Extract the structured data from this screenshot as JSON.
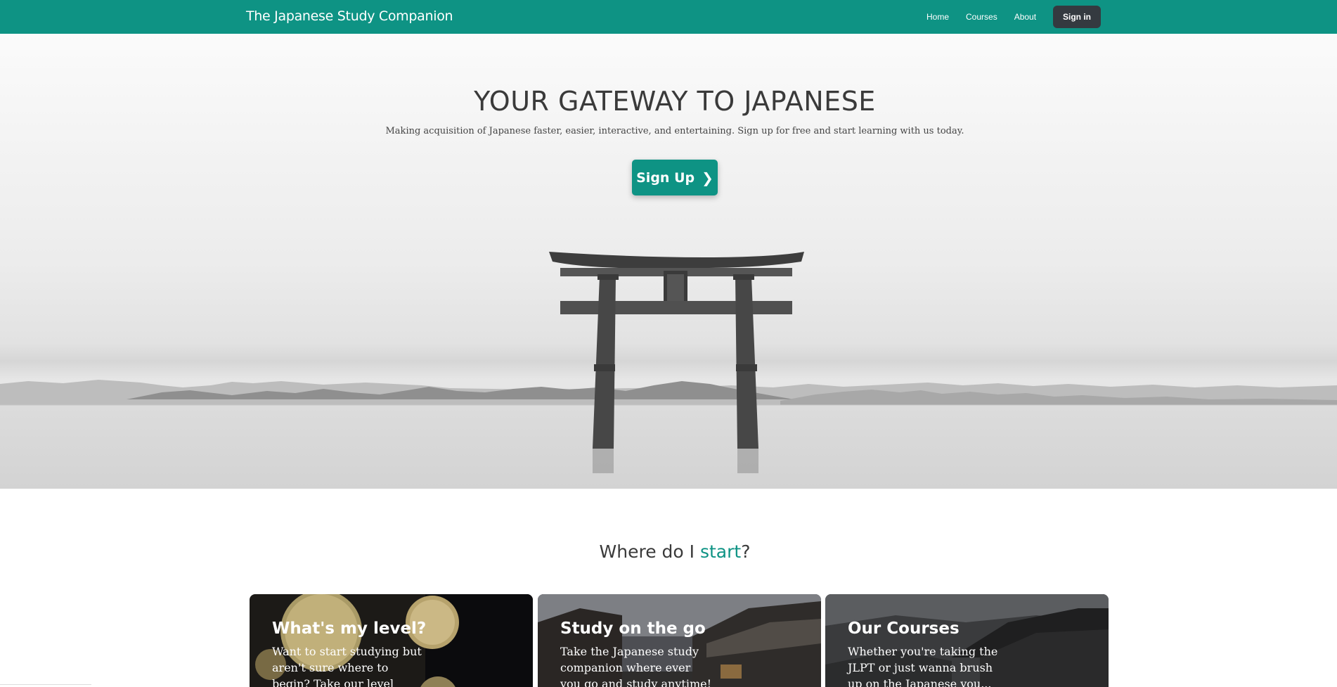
{
  "navbar": {
    "brand": "The Japanese Study Companion",
    "links": [
      "Home",
      "Courses",
      "About"
    ],
    "signin_label": "Sign in",
    "bg_color": "#0e9384"
  },
  "hero": {
    "title": "YOUR GATEWAY TO JAPANESE",
    "subtitle": "Making acquisition of Japanese faster, easier, interactive, and entertaining. Sign up for free and start learning with us today.",
    "signup_label": "Sign Up",
    "signup_icon": "chevron-right-icon"
  },
  "section": {
    "title_prefix": "Where do I ",
    "title_accent": "start",
    "title_suffix": "?",
    "accent_color": "#0e9384"
  },
  "cards": [
    {
      "title": "What's my level?",
      "text": "Want to start studying but aren't sure where to begin? Take our level assessment..."
    },
    {
      "title": "Study on the go",
      "text": "Take the Japanese study companion where ever you go and study anytime!"
    },
    {
      "title": "Our Courses",
      "text": "Whether you're taking the JLPT or just wanna brush up on the Japanese you..."
    }
  ]
}
